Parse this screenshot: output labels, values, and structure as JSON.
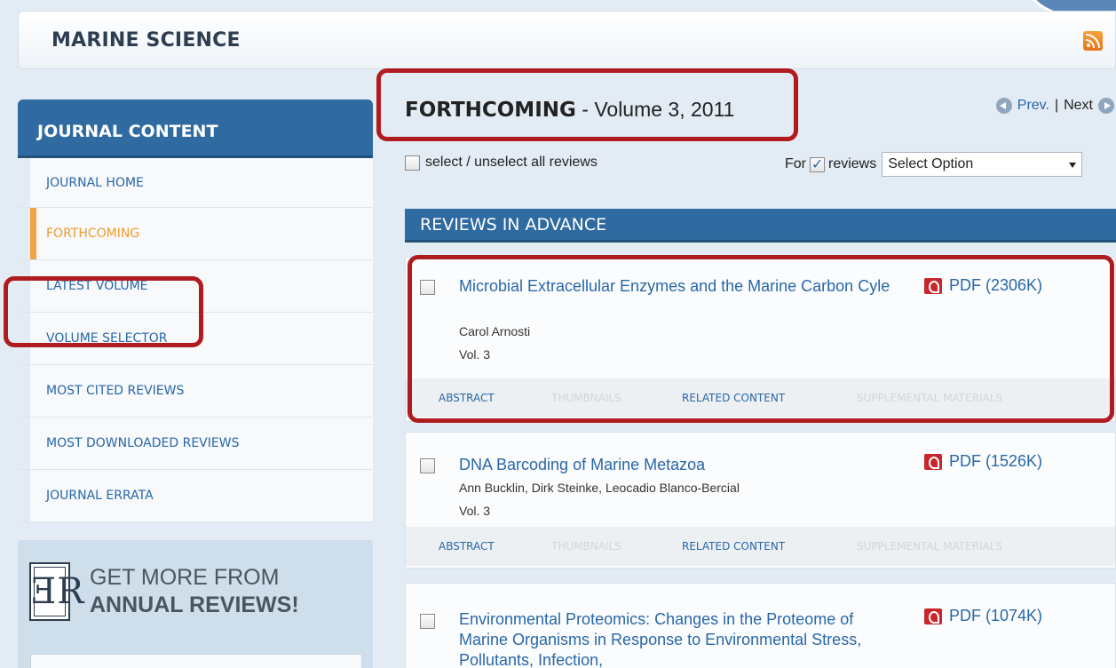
{
  "header": {
    "title": "MARINE SCIENCE",
    "rss_icon": "rss-icon"
  },
  "sidebar": {
    "title": "JOURNAL CONTENT",
    "items": [
      {
        "label": "JOURNAL HOME",
        "active": false
      },
      {
        "label": "FORTHCOMING",
        "active": true
      },
      {
        "label": "LATEST VOLUME",
        "active": false
      },
      {
        "label": "VOLUME SELECTOR",
        "active": false
      },
      {
        "label": "MOST CITED REVIEWS",
        "active": false
      },
      {
        "label": "MOST DOWNLOADED REVIEWS",
        "active": false
      },
      {
        "label": "JOURNAL ERRATA",
        "active": false
      }
    ],
    "promo": {
      "line1": "GET MORE FROM",
      "line2": "ANNUAL REVIEWS!",
      "logo": "AR"
    }
  },
  "main": {
    "heading_strong": "FORTHCOMING",
    "heading_rest": " - Volume 3, 2011",
    "pager": {
      "prev": "Prev.",
      "separator": "|",
      "next": "Next"
    },
    "select_all": "select / unselect all reviews",
    "for_label": "For",
    "for_reviews": "reviews",
    "select_value": "Select Option",
    "section_title": "REVIEWS IN ADVANCE",
    "articles": [
      {
        "title": "Microbial Extracellular Enzymes and the Marine Carbon Cyle",
        "authors": "Carol Arnosti",
        "vol": "Vol. 3",
        "pdf": "PDF (2306K)",
        "tabs": [
          "ABSTRACT",
          "THUMBNAILS",
          "RELATED CONTENT",
          "SUPPLEMENTAL MATERIALS"
        ]
      },
      {
        "title": "DNA Barcoding of Marine Metazoa",
        "authors": "Ann Bucklin, Dirk Steinke, Leocadio Blanco-Bercial",
        "vol": "Vol. 3",
        "pdf": "PDF (1526K)",
        "tabs": [
          "ABSTRACT",
          "THUMBNAILS",
          "RELATED CONTENT",
          "SUPPLEMENTAL MATERIALS"
        ]
      },
      {
        "title": "Environmental Proteomics: Changes in the Proteome of Marine Organisms in Response to Environmental Stress, Pollutants, Infection,",
        "pdf": "PDF (1074K)"
      }
    ]
  },
  "colors": {
    "accent": "#2f6aa0",
    "link": "#2867a8",
    "active": "#f09a2e",
    "highlight": "#b01b1f"
  }
}
